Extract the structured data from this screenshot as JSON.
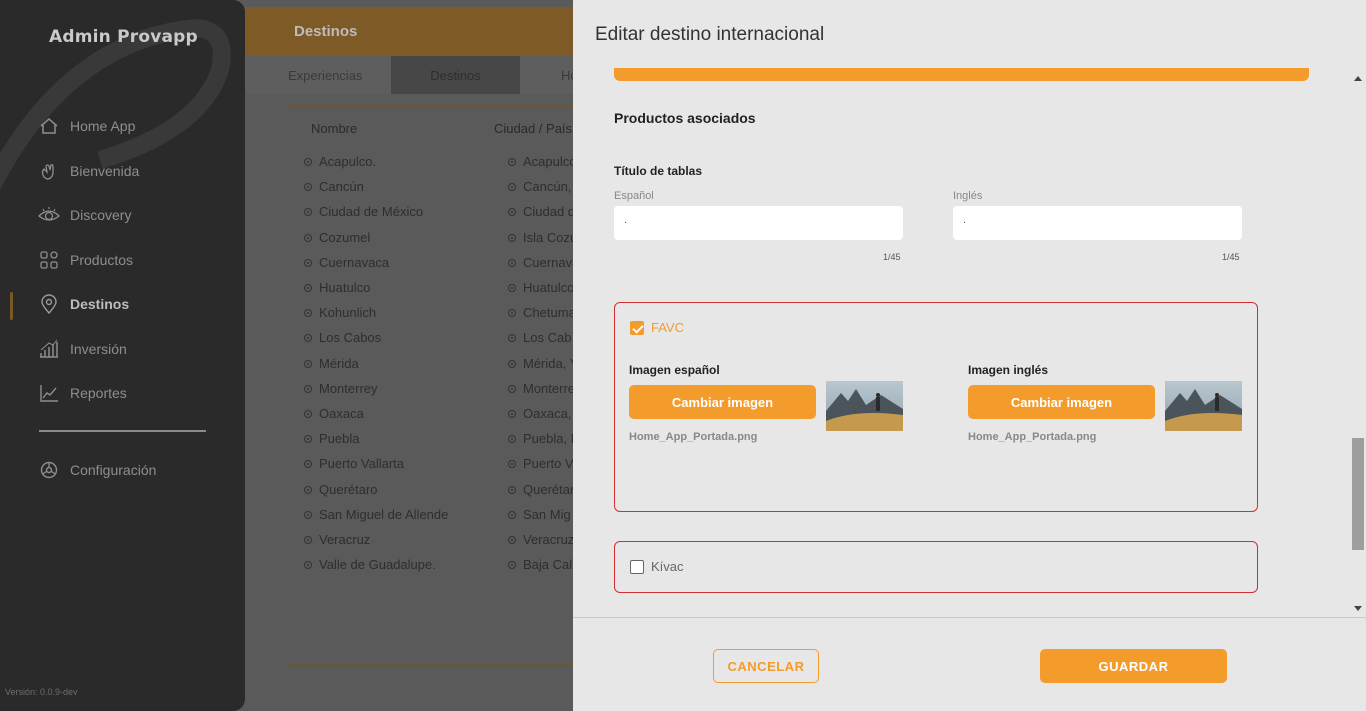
{
  "sidebar": {
    "brand": "Admin Provapp",
    "items": [
      {
        "label": "Home App",
        "icon": "home-icon"
      },
      {
        "label": "Bienvenida",
        "icon": "wave-hand-icon"
      },
      {
        "label": "Discovery",
        "icon": "eye-icon"
      },
      {
        "label": "Productos",
        "icon": "grid-icon"
      },
      {
        "label": "Destinos",
        "icon": "location-pin-icon",
        "active": true
      },
      {
        "label": "Inversión",
        "icon": "bar-chart-icon"
      },
      {
        "label": "Reportes",
        "icon": "line-chart-icon"
      }
    ],
    "settings": {
      "label": "Configuración",
      "icon": "gear-icon"
    },
    "version": "Versión: 0.0.9-dev"
  },
  "background": {
    "header_title": "Destinos",
    "tabs": [
      "Experiencias",
      "Destinos",
      "Ho"
    ],
    "columns": [
      "Nombre",
      "Ciudad / País"
    ],
    "rows": [
      [
        "Acapulco.",
        "Acapulco"
      ],
      [
        "Cancún",
        "Cancún,"
      ],
      [
        "Ciudad de México",
        "Ciudad d"
      ],
      [
        "Cozumel",
        "Isla Cozu"
      ],
      [
        "Cuernavaca",
        "Cuernava"
      ],
      [
        "Huatulco",
        "Huatulco"
      ],
      [
        "Kohunlich",
        "Chetuma"
      ],
      [
        "Los Cabos",
        "Los Cab"
      ],
      [
        "Mérida",
        "Mérida, Y"
      ],
      [
        "Monterrey",
        "Monterre"
      ],
      [
        "Oaxaca",
        "Oaxaca,"
      ],
      [
        "Puebla",
        "Puebla, P"
      ],
      [
        "Puerto Vallarta",
        "Puerto V"
      ],
      [
        "Querétaro",
        "Querétar"
      ],
      [
        "San Miguel de Allende",
        "San Mig"
      ],
      [
        "Veracruz",
        "Veracruz"
      ],
      [
        "Valle de Guadalupe.",
        "Baja Cal"
      ]
    ]
  },
  "modal": {
    "title": "Editar destino internacional",
    "section_title": "Productos asociados",
    "table_title_label": "Título de tablas",
    "spanish_label": "Español",
    "english_label": "Inglés",
    "spanish_value": ".",
    "english_value": ".",
    "spanish_counter": "1/45",
    "english_counter": "1/45",
    "favc": {
      "label": "FAVC",
      "checked": true,
      "image_es_label": "Imagen español",
      "image_en_label": "Imagen inglés",
      "change_button": "Cambiar imagen",
      "file_es": "Home_App_Portada.png",
      "file_en": "Home_App_Portada.png"
    },
    "kivac": {
      "label": "Kívac",
      "checked": false
    },
    "cancel": "CANCELAR",
    "save": "GUARDAR"
  },
  "colors": {
    "accent": "#f39c2c",
    "error_border": "#d32f2f",
    "sidebar_bg": "#2a2a2a",
    "modal_bg": "#e7e7e7"
  }
}
